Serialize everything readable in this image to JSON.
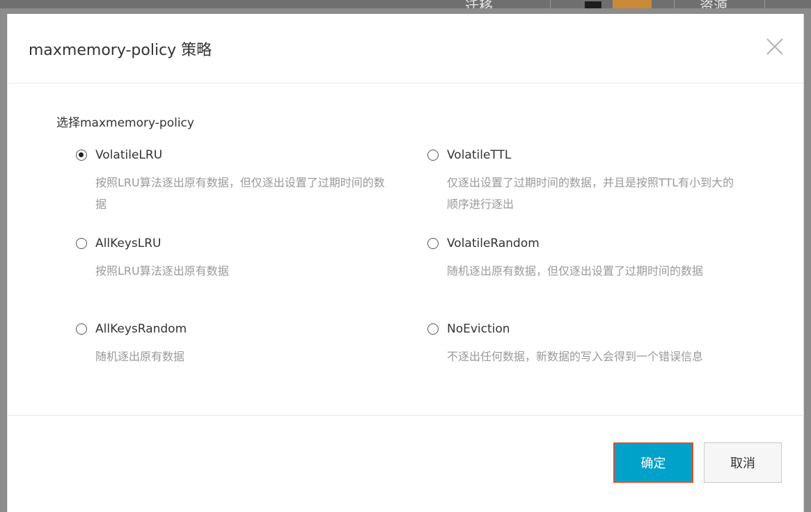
{
  "background": {
    "nav_items": [
      "迁移",
      "资源"
    ]
  },
  "dialog": {
    "title": "maxmemory-policy 策略",
    "close_icon": "close-icon",
    "field_label": "选择maxmemory-policy",
    "selected": "VolatileLRU",
    "options": [
      {
        "label": "VolatileLRU",
        "desc": "按照LRU算法逐出原有数据，但仅逐出设置了过期时间的数据",
        "checked": true
      },
      {
        "label": "VolatileTTL",
        "desc": "仅逐出设置了过期时间的数据，并且是按照TTL有小到大的顺序进行逐出",
        "checked": false
      },
      {
        "label": "AllKeysLRU",
        "desc": "按照LRU算法逐出原有数据",
        "checked": false
      },
      {
        "label": "VolatileRandom",
        "desc": "随机逐出原有数据，但仅逐出设置了过期时间的数据",
        "checked": false
      },
      {
        "label": "AllKeysRandom",
        "desc": "随机逐出原有数据",
        "checked": false
      },
      {
        "label": "NoEviction",
        "desc": "不逐出任何数据，新数据的写入会得到一个错误信息",
        "checked": false
      }
    ],
    "buttons": {
      "ok": "确定",
      "cancel": "取消"
    }
  },
  "colors": {
    "primary_button": "#00a2ca",
    "focus_outline": "#e0502a"
  }
}
